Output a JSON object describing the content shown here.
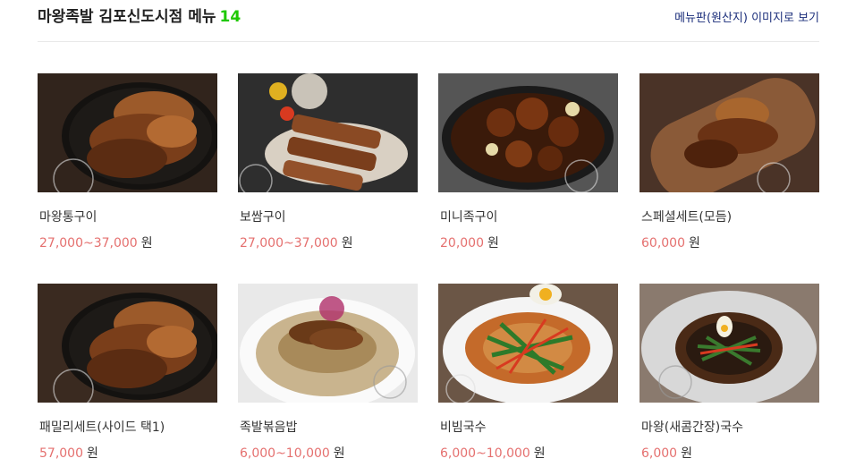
{
  "header": {
    "store_title": "마왕족발 김포신도시점 메뉴",
    "menu_count": "14",
    "menu_image_link": "메뉴판(원산지) 이미지로 보기"
  },
  "menu": [
    {
      "name": "마왕통구이",
      "price": "27,000~37,000",
      "unit": "원",
      "dish": "grilled-pork-hock"
    },
    {
      "name": "보쌈구이",
      "price": "27,000~37,000",
      "unit": "원",
      "dish": "grilled-bossam"
    },
    {
      "name": "미니족구이",
      "price": "20,000",
      "unit": "원",
      "dish": "mini-jokbal-skillet"
    },
    {
      "name": "스페셜세트(모듬)",
      "price": "60,000",
      "unit": "원",
      "dish": "special-set-platter"
    },
    {
      "name": "패밀리세트(사이드 택1)",
      "price": "57,000",
      "unit": "원",
      "dish": "family-set"
    },
    {
      "name": "족발볶음밥",
      "price": "6,000~10,000",
      "unit": "원",
      "dish": "jokbal-fried-rice"
    },
    {
      "name": "비빔국수",
      "price": "6,000~10,000",
      "unit": "원",
      "dish": "bibim-noodles"
    },
    {
      "name": "마왕(새콤간장)국수",
      "price": "6,000",
      "unit": "원",
      "dish": "soy-noodles"
    }
  ],
  "colors": {
    "accent_green": "#1ec800",
    "price_red": "#e5706f",
    "link_blue": "#1a2d7a"
  }
}
